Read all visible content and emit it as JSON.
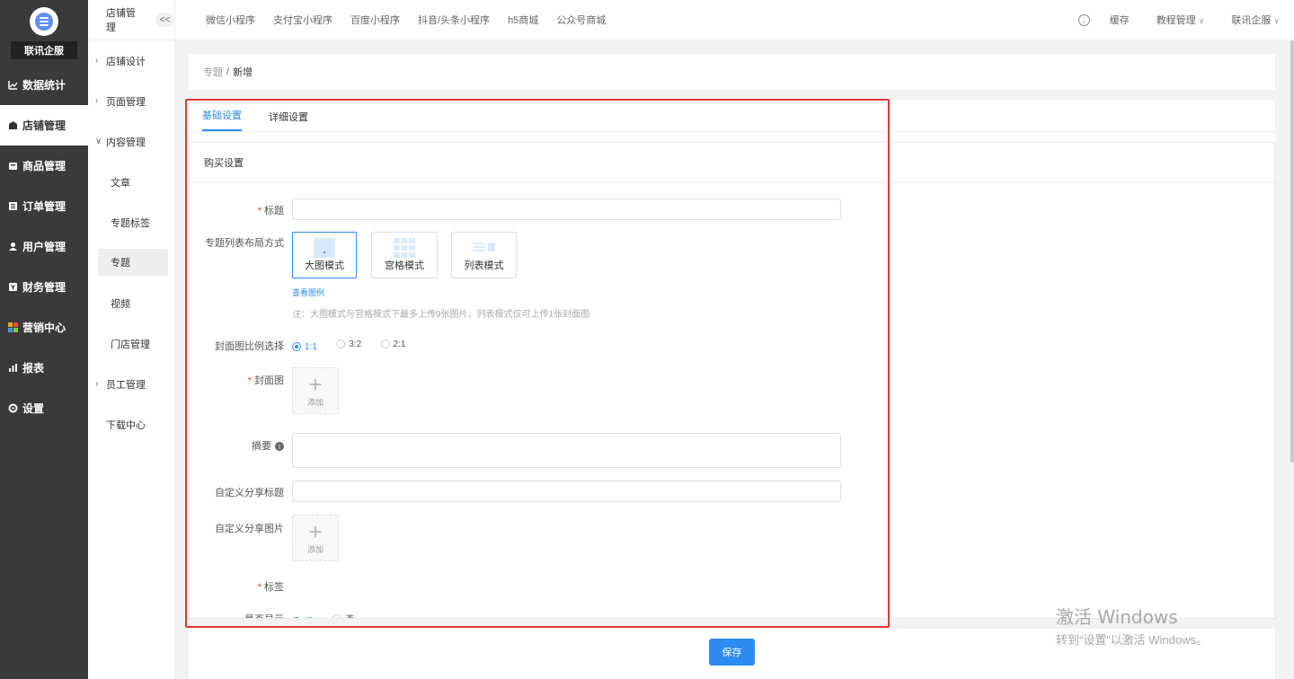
{
  "sidebar": {
    "brand": "联讯企服",
    "items": [
      {
        "label": "数据统计",
        "icon": "chart-icon",
        "active": false
      },
      {
        "label": "店铺管理",
        "icon": "shop-icon",
        "active": true
      },
      {
        "label": "商品管理",
        "icon": "goods-icon",
        "active": false
      },
      {
        "label": "订单管理",
        "icon": "order-icon",
        "active": false
      },
      {
        "label": "用户管理",
        "icon": "user-icon",
        "active": false
      },
      {
        "label": "财务管理",
        "icon": "finance-icon",
        "active": false
      },
      {
        "label": "营销中心",
        "icon": "marketing-icon",
        "active": false
      },
      {
        "label": "报表",
        "icon": "report-icon",
        "active": false
      },
      {
        "label": "设置",
        "icon": "gear-icon",
        "active": false
      }
    ]
  },
  "submenu": {
    "title": "店铺管理",
    "collapse": "<<",
    "items": {
      "store_design": "店铺设计",
      "page_mgmt": "页面管理",
      "content_mgmt": "内容管理",
      "article": "文章",
      "topic_tag": "专题标签",
      "topic": "专题",
      "video": "视频",
      "store_mgmt": "门店管理",
      "staff_mgmt": "员工管理",
      "download": "下载中心"
    }
  },
  "topbar": {
    "links": [
      "微信小程序",
      "支付宝小程序",
      "百度小程序",
      "抖音/头条小程序",
      "h5商城",
      "公众号商城"
    ],
    "cache": "缓存",
    "tutorial": "教程管理",
    "account": "联讯企服"
  },
  "breadcrumb": {
    "parent": "专题",
    "sep": "/",
    "current": "新增"
  },
  "tabs": {
    "basic": "基础设置",
    "detail": "详细设置"
  },
  "form": {
    "section_title": "购买设置",
    "title_label": "标题",
    "layout_label": "专题列表布局方式",
    "layout_options": [
      "大图模式",
      "宫格模式",
      "列表模式"
    ],
    "view_example": "查看图例",
    "layout_note": "注：大图模式与宫格模式下最多上传9张图片，列表模式仅可上传1张封面图",
    "ratio_label": "封面图比例选择",
    "ratio_options": [
      "1:1",
      "3:2",
      "2:1"
    ],
    "cover_label": "封面图",
    "add_text": "添加",
    "summary_label": "摘要",
    "share_title_label": "自定义分享标题",
    "share_image_label": "自定义分享图片",
    "tag_label": "标签",
    "show_label": "是否显示",
    "show_yes": "是",
    "show_no": "否"
  },
  "save_button": "保存",
  "watermark": {
    "line1": "激活 Windows",
    "line2": "转到“设置”以激活 Windows。"
  },
  "colors": {
    "primary": "#2d8cf0",
    "sidebar_bg": "#3a3a3a",
    "highlight": "#e53935"
  }
}
